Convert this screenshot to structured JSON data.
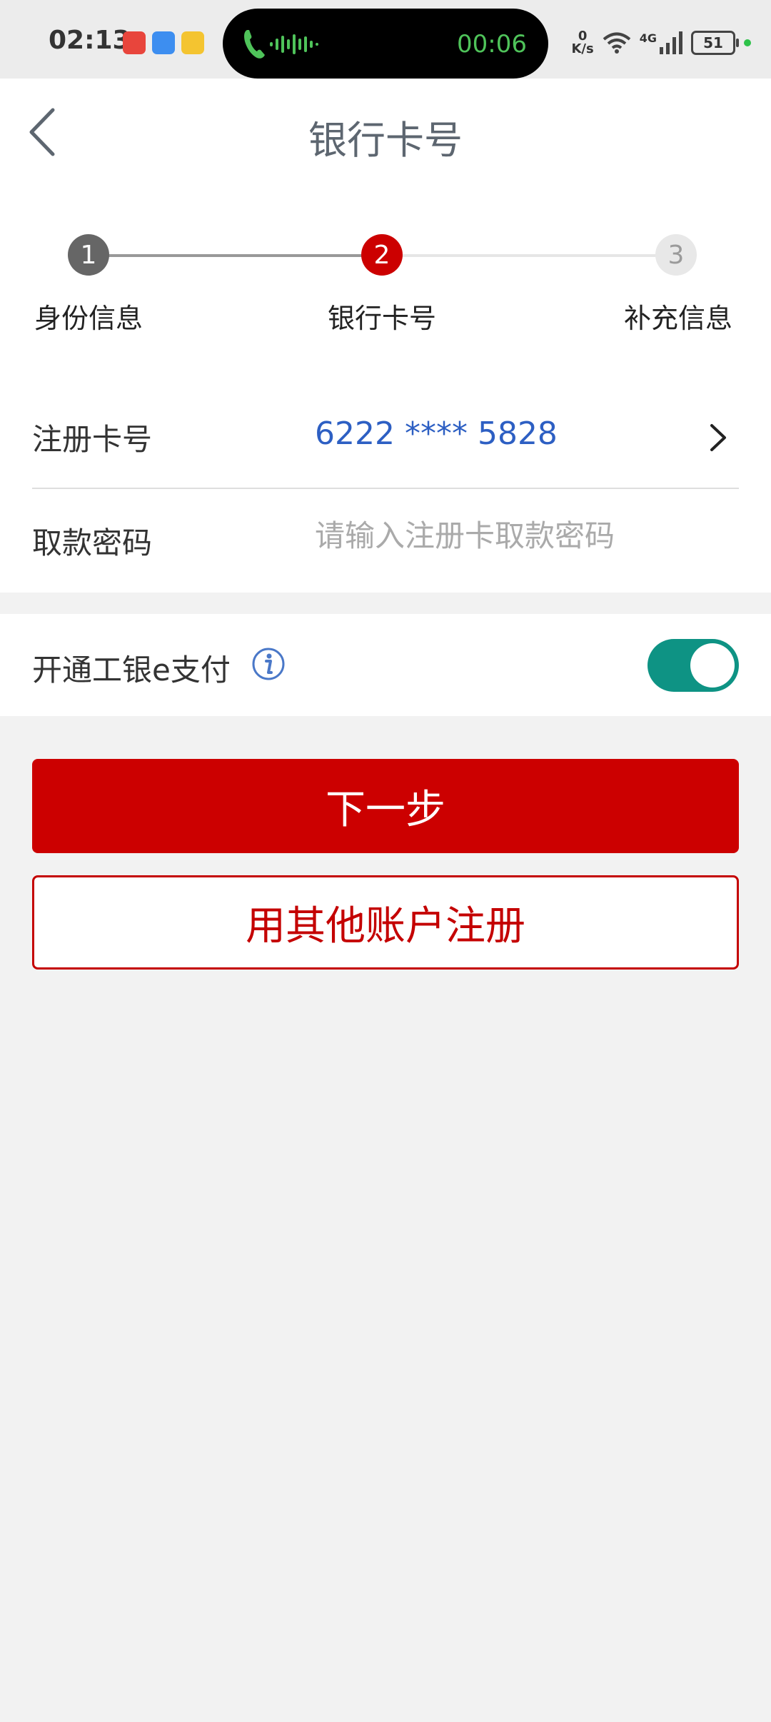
{
  "status_bar": {
    "time": "02:13",
    "call_timer": "00:06",
    "net_speed_value": "0",
    "net_speed_unit": "K/s",
    "network": "4G",
    "battery": "51"
  },
  "header": {
    "title": "银行卡号"
  },
  "stepper": {
    "current_step": 2,
    "steps": [
      {
        "number": "1",
        "label": "身份信息",
        "state": "done"
      },
      {
        "number": "2",
        "label": "银行卡号",
        "state": "active"
      },
      {
        "number": "3",
        "label": "补充信息",
        "state": "pending"
      }
    ]
  },
  "form": {
    "card_label": "注册卡号",
    "card_value": "6222 **** 5828",
    "password_label": "取款密码",
    "password_placeholder": "请输入注册卡取款密码"
  },
  "epay": {
    "label": "开通工银e支付",
    "enabled": true
  },
  "actions": {
    "next_label": "下一步",
    "other_account_label": "用其他账户注册"
  },
  "colors": {
    "primary_red": "#cc0000",
    "toggle_on": "#0e9384",
    "link_blue": "#2d5fc3"
  }
}
